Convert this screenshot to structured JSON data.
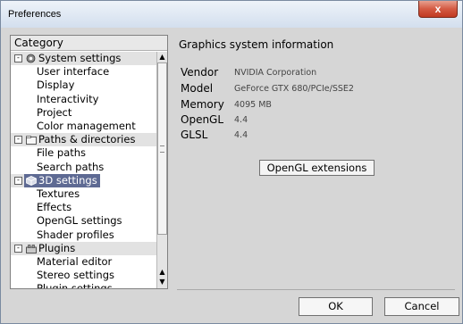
{
  "window": {
    "title": "Preferences",
    "close_symbol": "x"
  },
  "category": {
    "header": "Category",
    "tree": [
      {
        "type": "group",
        "label": "System settings",
        "expander": "-",
        "icon": "gear-icon"
      },
      {
        "type": "child",
        "label": "User interface"
      },
      {
        "type": "child",
        "label": "Display"
      },
      {
        "type": "child",
        "label": "Interactivity"
      },
      {
        "type": "child",
        "label": "Project"
      },
      {
        "type": "child",
        "label": "Color management"
      },
      {
        "type": "group",
        "label": "Paths & directories",
        "expander": "-",
        "icon": "folder-icon"
      },
      {
        "type": "child",
        "label": "File paths"
      },
      {
        "type": "child",
        "label": "Search paths"
      },
      {
        "type": "group",
        "label": "3D settings",
        "expander": "-",
        "icon": "cube-icon",
        "selected": true
      },
      {
        "type": "child",
        "label": "Textures"
      },
      {
        "type": "child",
        "label": "Effects"
      },
      {
        "type": "child",
        "label": "OpenGL settings"
      },
      {
        "type": "child",
        "label": "Shader profiles"
      },
      {
        "type": "group",
        "label": "Plugins",
        "expander": "-",
        "icon": "plugin-icon"
      },
      {
        "type": "child",
        "label": "Material editor"
      },
      {
        "type": "child",
        "label": "Stereo settings"
      },
      {
        "type": "child",
        "label": "Plugin settings"
      }
    ]
  },
  "graphics": {
    "title": "Graphics system information",
    "rows": [
      {
        "label": "Vendor",
        "value": "NVIDIA Corporation"
      },
      {
        "label": "Model",
        "value": "GeForce GTX 680/PCIe/SSE2"
      },
      {
        "label": "Memory",
        "value": "4095 MB"
      },
      {
        "label": "OpenGL",
        "value": "4.4"
      },
      {
        "label": "GLSL",
        "value": "4.4"
      }
    ],
    "extensions_button": "OpenGL extensions"
  },
  "footer": {
    "ok": "OK",
    "cancel": "Cancel"
  }
}
